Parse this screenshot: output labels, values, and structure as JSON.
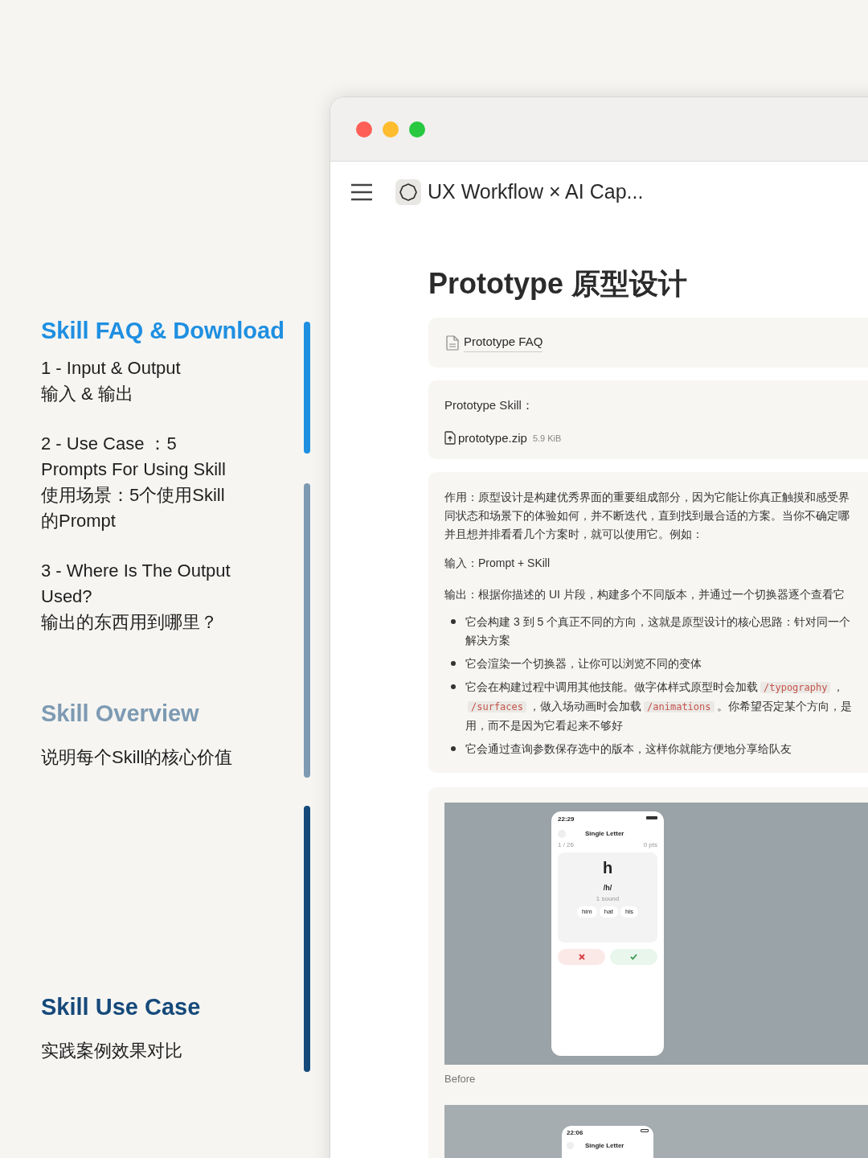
{
  "sections": [
    {
      "title": "Skill FAQ & Download",
      "color": "#1e8fe1",
      "items": [
        {
          "lines": [
            "1 - Input & Output",
            "输入 & 输出"
          ]
        },
        {
          "lines": [
            "2 - Use Case ：5",
            "Prompts For Using Skill",
            "使用场景：5个使用Skill",
            "的Prompt"
          ]
        },
        {
          "lines": [
            "3 - Where Is The Output",
            "Used?",
            "输出的东西用到哪里？"
          ]
        }
      ]
    },
    {
      "title": "Skill Overview",
      "color": "#7d9ab2",
      "items": [
        {
          "lines": [
            "说明每个Skill的核心价值"
          ]
        }
      ]
    },
    {
      "title": "Skill Use Case",
      "color": "#15497a",
      "items": [
        {
          "lines": [
            "实践案例效果对比"
          ]
        }
      ]
    }
  ],
  "window": {
    "workspace_title": "UX Workflow × AI Cap...",
    "page_title": "Prototype 原型设计",
    "faq_link": "Prototype FAQ",
    "download": {
      "label": "Prototype Skill：",
      "file": "prototype.zip",
      "size": "5.9 KiB"
    },
    "description": {
      "lines": [
        "作用：原型设计是构建优秀界面的重要组成部分，因为它能让你真正触摸和感受界",
        "同状态和场景下的体验如何，并不断迭代，直到找到最合适的方案。当你不确定哪",
        "并且想并排看看几个方案时，就可以使用它。例如："
      ],
      "input": "输入：Prompt + SKill",
      "output": "输出：根据你描述的 UI 片段，构建多个不同版本，并通过一个切换器逐个查看它",
      "bullets": [
        [
          {
            "kind": "text",
            "text": "它会构建 3 到 5 个真正不同的方向，这就是原型设计的核心思路：针对同一个"
          },
          {
            "kind": "break"
          },
          {
            "kind": "text",
            "text": "解决方案"
          }
        ],
        [
          {
            "kind": "text",
            "text": "它会渲染一个切换器，让你可以浏览不同的变体"
          }
        ],
        [
          {
            "kind": "text",
            "text": "它会在构建过程中调用其他技能。做字体样式原型时会加载"
          },
          {
            "kind": "code",
            "text": "/typography"
          },
          {
            "kind": "text",
            "text": "，"
          },
          {
            "kind": "break"
          },
          {
            "kind": "code",
            "text": "/surfaces"
          },
          {
            "kind": "text",
            "text": "，做入场动画时会加载"
          },
          {
            "kind": "code",
            "text": "/animations"
          },
          {
            "kind": "text",
            "text": "。你希望否定某个方向，是"
          },
          {
            "kind": "break"
          },
          {
            "kind": "text",
            "text": "用，而不是因为它看起来不够好"
          }
        ],
        [
          {
            "kind": "text",
            "text": "它会通过查询参数保存选中的版本，这样你就能方便地分享给队友"
          }
        ]
      ]
    },
    "before": {
      "caption": "Before",
      "phone": {
        "time": "22:29",
        "title": "Single Letter",
        "progress": "1 / 26",
        "points": "0 pts",
        "letter": "h",
        "sound": "/h/",
        "sound_count": "1 sound",
        "words": [
          "him",
          "hat",
          "his"
        ]
      }
    },
    "after": {
      "phone": {
        "time": "22:06",
        "title": "Single Letter"
      }
    }
  }
}
